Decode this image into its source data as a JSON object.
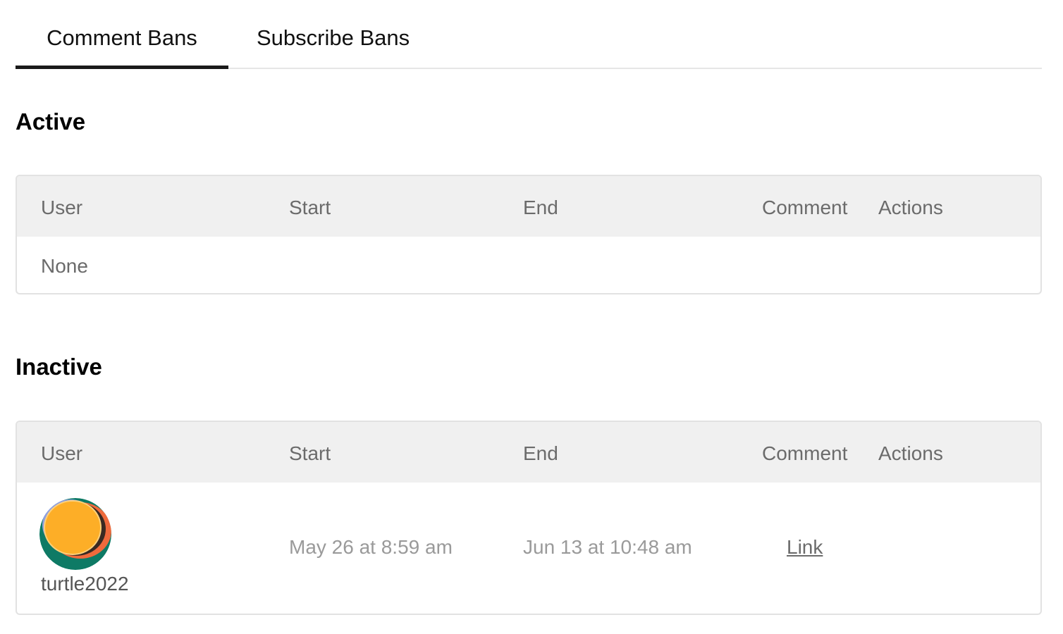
{
  "tabs": [
    {
      "label": "Comment Bans",
      "active": true
    },
    {
      "label": "Subscribe Bans",
      "active": false
    }
  ],
  "active_section": {
    "title": "Active",
    "columns": [
      "User",
      "Start",
      "End",
      "Comment",
      "Actions"
    ],
    "empty_text": "None"
  },
  "inactive_section": {
    "title": "Inactive",
    "columns": [
      "User",
      "Start",
      "End",
      "Comment",
      "Actions"
    ],
    "rows": [
      {
        "user": "turtle2022",
        "avatar_icon": "user-avatar-icon",
        "start": "May 26 at 8:59 am",
        "end": "Jun 13 at 10:48 am",
        "comment_link": "Link"
      }
    ]
  },
  "colors": {
    "header_bg": "#f0f0f0",
    "active_tab_underline": "#1a1a1a",
    "avatar_orange": "#fdae27",
    "avatar_green": "#0e7a65",
    "avatar_red": "#f06a3c",
    "avatar_purple": "#8f9fe0"
  }
}
